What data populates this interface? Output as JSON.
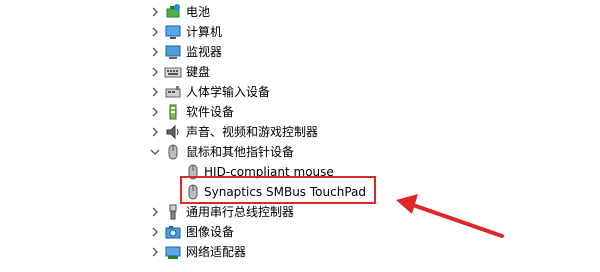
{
  "tree": {
    "items": [
      {
        "label": "电池",
        "icon": "battery-icon",
        "expanded": false
      },
      {
        "label": "计算机",
        "icon": "computer-icon",
        "expanded": false
      },
      {
        "label": "监视器",
        "icon": "monitor-icon",
        "expanded": false
      },
      {
        "label": "键盘",
        "icon": "keyboard-icon",
        "expanded": false
      },
      {
        "label": "人体学输入设备",
        "icon": "hid-icon",
        "expanded": false
      },
      {
        "label": "软件设备",
        "icon": "software-device-icon",
        "expanded": false
      },
      {
        "label": "声音、视频和游戏控制器",
        "icon": "speaker-icon",
        "expanded": false
      },
      {
        "label": "鼠标和其他指针设备",
        "icon": "mouse-icon",
        "expanded": true,
        "children": [
          {
            "label": "HID-compliant mouse",
            "icon": "mouse-icon"
          },
          {
            "label": "Synaptics SMBus TouchPad",
            "icon": "mouse-icon",
            "highlighted": true
          }
        ]
      },
      {
        "label": "通用串行总线控制器",
        "icon": "usb-icon",
        "expanded": false
      },
      {
        "label": "图像设备",
        "icon": "camera-icon",
        "expanded": false
      },
      {
        "label": "网络适配器",
        "icon": "network-adapter-icon",
        "expanded": false
      }
    ]
  },
  "annotation": {
    "highlight_color": "#e02727",
    "arrow_color": "#e02727"
  }
}
